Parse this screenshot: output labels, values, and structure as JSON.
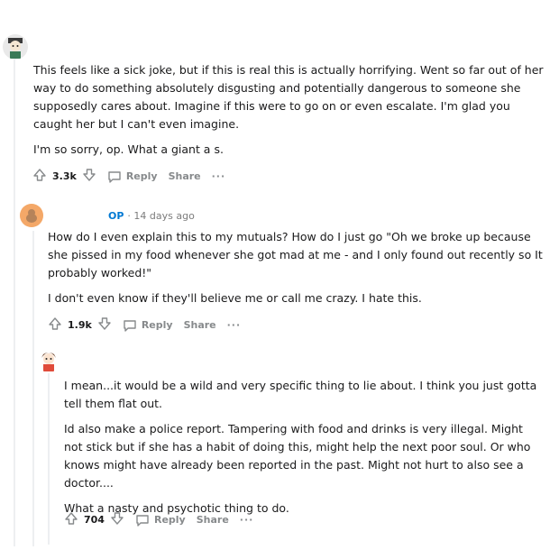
{
  "comments": [
    {
      "meta": "",
      "paragraphs": [
        "This feels like a sick joke, but if this is real this is actually horrifying. Went so far out of her way to do something absolutely disgusting and potentially dangerous to someone she supposedly cares about. Imagine if this were to go on or even escalate. I'm glad you caught her but I can't even imagine.",
        "I'm so sorry, op. What a giant a s."
      ],
      "votes": "3.3k",
      "reply": "Reply",
      "share": "Share",
      "more": "···"
    },
    {
      "meta_op": "OP",
      "meta_time": "· 14 days ago",
      "paragraphs": [
        "How do I even explain this to my mutuals? How do I just go \"Oh we broke up because she pissed in my food whenever she got mad at me - and I only found out recently so It probably worked!\"",
        "I don't even know if they'll believe me or call me crazy. I hate this."
      ],
      "votes": "1.9k",
      "reply": "Reply",
      "share": "Share",
      "more": "···"
    },
    {
      "paragraphs": [
        "I mean...it would be a wild and very specific thing to lie about. I think you just gotta tell them flat out.",
        "Id also make a police report. Tampering with food and drinks is very illegal. Might not stick but if she has a habit of doing this, might help the next poor soul. Or who knows might have already been reported in the past. Might not hurt to also see a doctor....",
        "What a nasty and psychotic thing to do."
      ],
      "votes": "704",
      "reply": "Reply",
      "share": "Share",
      "more": "···"
    }
  ],
  "colors": {
    "op": "#0079d3",
    "text": "#1a1a1b",
    "muted": "#878a8c",
    "thread_line": "#edeff1"
  },
  "icons": [
    "upvote-icon",
    "downvote-icon",
    "comment-bubble-icon",
    "avatar-icon"
  ]
}
